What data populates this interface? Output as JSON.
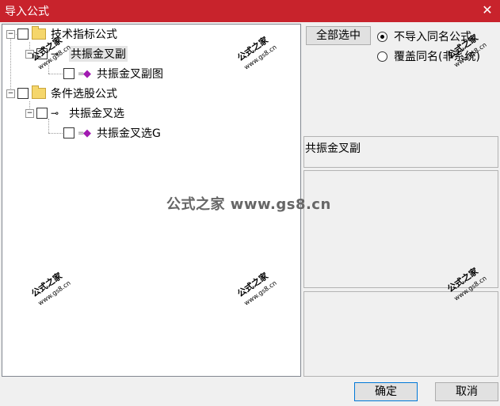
{
  "window": {
    "title": "导入公式",
    "close_glyph": "✕"
  },
  "tree": {
    "nodes": [
      {
        "label": "技术指标公式",
        "expander": "−",
        "icon": "folder-icon"
      },
      {
        "label": "共振金叉副",
        "expander": "−",
        "icon": "key-icon"
      },
      {
        "label": "共振金叉副图",
        "icon": "gem-icon"
      },
      {
        "label": "条件选股公式",
        "expander": "−",
        "icon": "folder-icon"
      },
      {
        "label": "共振金叉选",
        "expander": "−",
        "icon": "key-icon"
      },
      {
        "label": "共振金叉选G",
        "icon": "gem-icon"
      }
    ]
  },
  "right": {
    "select_all_label": "全部选中",
    "option_no_import": "不导入同名公式",
    "option_overwrite": "覆盖同名(非系统)",
    "selected_name": "共振金叉副"
  },
  "footer": {
    "ok_label": "确定",
    "cancel_label": "取消"
  },
  "watermarks": {
    "title": "公式之家",
    "url": "www.gs8.cn",
    "center": "公式之家 www.gs8.cn"
  }
}
